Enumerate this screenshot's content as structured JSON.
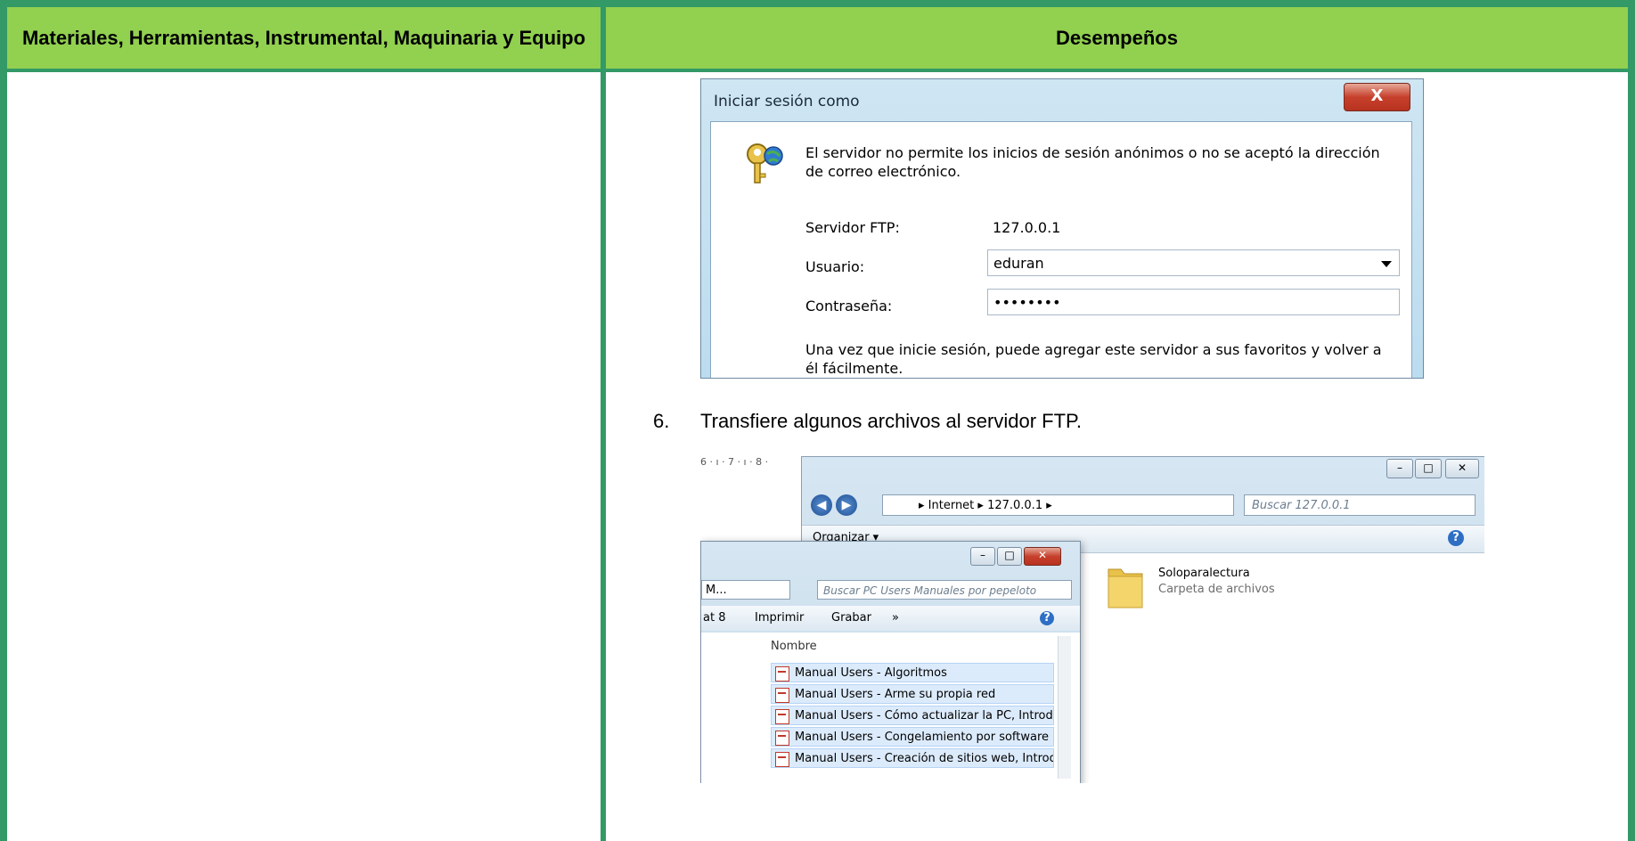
{
  "table": {
    "header_left": "Materiales, Herramientas, Instrumental, Maquinaria y Equipo",
    "header_right": "Desempeños",
    "colors": {
      "header_bg": "#92d050",
      "border": "#339966"
    }
  },
  "login_dialog": {
    "title": "Iniciar sesión como",
    "close_label": "X",
    "message": "El servidor no permite los inicios de sesión anónimos o no se aceptó la dirección de correo electrónico.",
    "server_label": "Servidor FTP:",
    "server_value": "127.0.0.1",
    "user_label": "Usuario:",
    "user_value": "eduran",
    "password_label": "Contraseña:",
    "password_value": "••••••••",
    "footer": "Una vez que inicie sesión, puede agregar este servidor a sus favoritos y volver a él fácilmente."
  },
  "step": {
    "number": "6.",
    "text": "Transfiere algunos archivos al servidor FTP."
  },
  "explorer_shot": {
    "ruler": "6 · ı · 7 · ı · 8 ·",
    "ftp_window": {
      "address": "▸ Internet ▸ 127.0.0.1 ▸",
      "search_placeholder": "Buscar 127.0.0.1",
      "organize": "Organizar ▾",
      "folder_name": "Soloparalectura",
      "folder_type": "Carpeta de archivos"
    },
    "local_window": {
      "address": "M...",
      "search_placeholder": "Buscar PC Users Manuales por pepeloto",
      "toolbar": {
        "item0": "at 8",
        "item1": "Imprimir",
        "item2": "Grabar",
        "item3": "»"
      },
      "column": "Nombre",
      "files": [
        "Manual Users - Algoritmos",
        "Manual Users - Arme su propia red",
        "Manual Users - Cómo actualizar la PC, Introduc",
        "Manual Users - Congelamiento por software",
        "Manual Users - Creación de sitios web, Introduc"
      ]
    }
  }
}
